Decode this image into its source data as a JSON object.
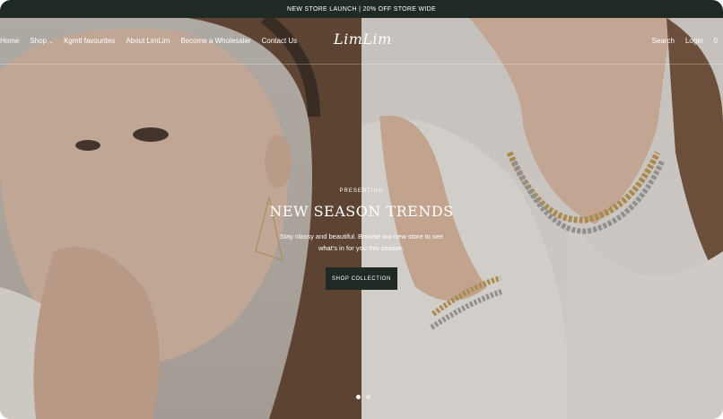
{
  "announcement": {
    "text": "NEW STORE LAUNCH | 20% OFF STORE WIDE"
  },
  "nav": {
    "items": [
      {
        "label": "Home"
      },
      {
        "label": "Shop"
      },
      {
        "label": "Kgmtl favourites"
      },
      {
        "label": "About LimLim"
      },
      {
        "label": "Become a Wholesaler"
      },
      {
        "label": "Contact Us"
      }
    ],
    "logo": "LimLim",
    "search_label": "Search",
    "login_label": "Login",
    "cart_count": "0"
  },
  "hero": {
    "eyebrow": "PRESENTING",
    "headline": "NEW SEASON TRENDS",
    "subtext_line1": "Stay classy and beautiful. Browse our new store to see",
    "subtext_line2": "what's in for you this season.",
    "cta_label": "SHOP COLLECTION",
    "slides_total": 2,
    "active_slide": 1
  },
  "colors": {
    "accent": "#1f2a25",
    "text_on_image": "#ffffff"
  }
}
